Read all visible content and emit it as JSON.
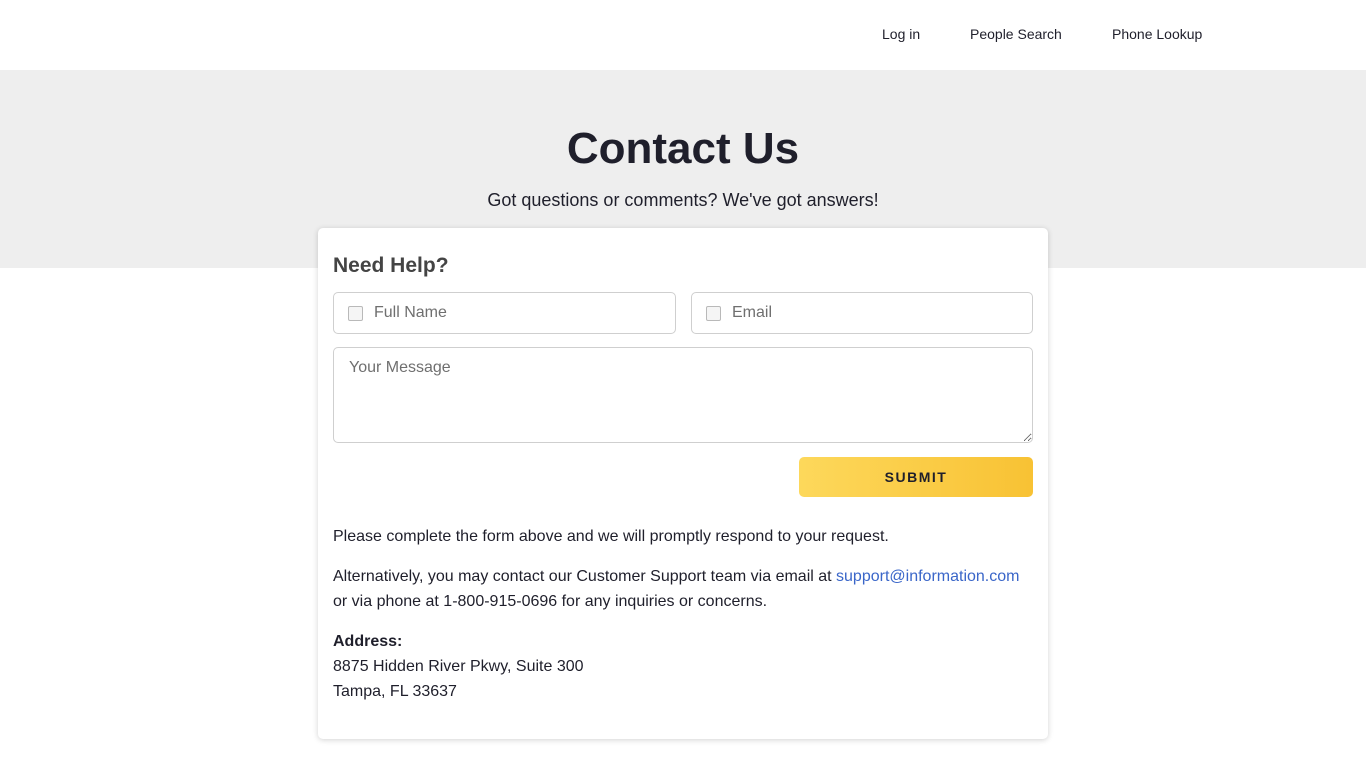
{
  "nav": {
    "login": "Log in",
    "people_search": "People Search",
    "phone_lookup": "Phone Lookup"
  },
  "hero": {
    "title": "Contact Us",
    "subtitle": "Got questions or comments? We've got answers!"
  },
  "form": {
    "title": "Need Help?",
    "full_name_placeholder": "Full Name",
    "email_placeholder": "Email",
    "message_placeholder": "Your Message",
    "submit_label": "SUBMIT"
  },
  "info": {
    "line1": "Please complete the form above and we will promptly respond to your request.",
    "line2_prefix": "Alternatively, you may contact our Customer Support team via email at ",
    "support_email": "support@information.com",
    "line2_suffix": "or via phone at 1-800-915-0696 for any inquiries or concerns.",
    "address_label": "Address:",
    "address_line1": "8875 Hidden River Pkwy, Suite 300",
    "address_line2": "Tampa, FL 33637"
  },
  "colors": {
    "hero_bg": "#eeeeee",
    "submit_gradient_start": "#fdd85b",
    "submit_gradient_end": "#f8c234",
    "link": "#3a66c9"
  },
  "icons": {
    "name_field": "broken-image-icon",
    "email_field": "broken-image-icon"
  }
}
